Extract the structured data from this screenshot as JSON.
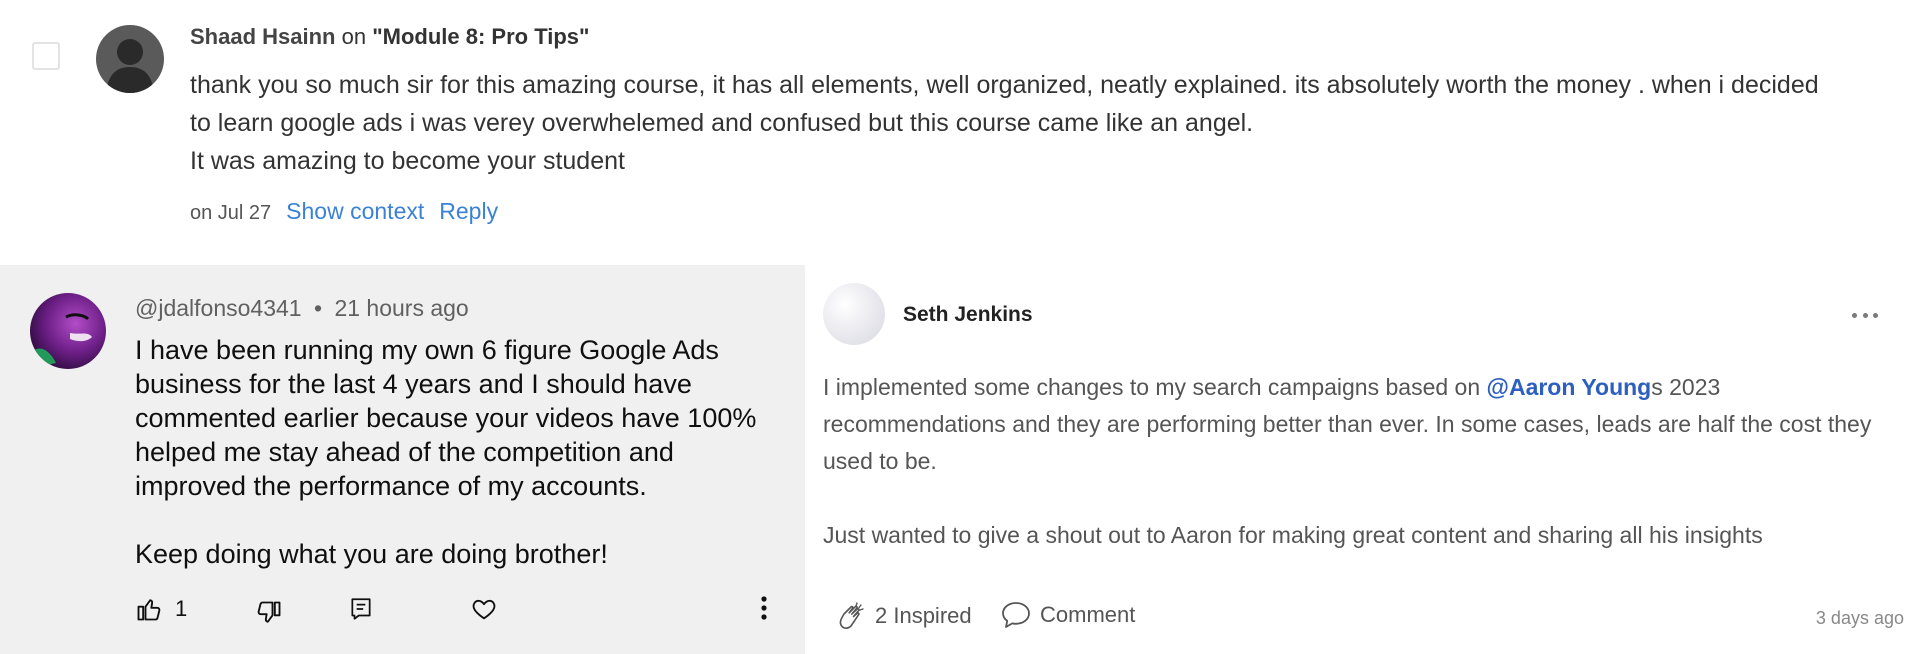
{
  "top_comment": {
    "author": "Shaad Hsainn",
    "on_word": "on",
    "module_quote": "\"Module 8: Pro Tips\"",
    "body_lines": [
      "thank you so much sir for this amazing course, it has all elements, well organized, neatly explained. its absolutely worth the money . when i decided",
      "to learn google ads i was verey overwhelemed and confused but this course came like an angel.",
      "It was amazing to become your student"
    ],
    "date": "on Jul 27",
    "show_context": "Show context",
    "reply": "Reply"
  },
  "youtube_comment": {
    "handle": "@jdalfonso4341",
    "separator": "•",
    "time": "21 hours ago",
    "paragraph1": "I have been running my own 6 figure Google Ads business for the last 4 years and I should have commented earlier because your videos have 100% helped me stay ahead of the competition and improved the performance of my accounts.",
    "paragraph2": "Keep doing what you are doing brother!",
    "like_count": "1",
    "icons": [
      "thumbs-up-icon",
      "thumbs-down-icon",
      "reply-icon",
      "heart-icon",
      "more-vertical-icon"
    ]
  },
  "post": {
    "author": "Seth Jenkins",
    "body_before_mention": "I implemented some changes to my search campaigns based on ",
    "mention": "@Aaron Young",
    "body_after_mention": "s 2023 recommendations and they are performing better than ever. In some cases, leads are half the cost they used to be.",
    "paragraph2": "Just wanted to give a shout out to Aaron for making great content and sharing all his insights",
    "inspired_label": "2 Inspired",
    "comment_label": "Comment",
    "time": "3 days ago"
  },
  "colors": {
    "link_blue": "#3b82d6",
    "mention_blue": "#2d5fbf",
    "yt_panel_bg": "#f0f0f0"
  }
}
